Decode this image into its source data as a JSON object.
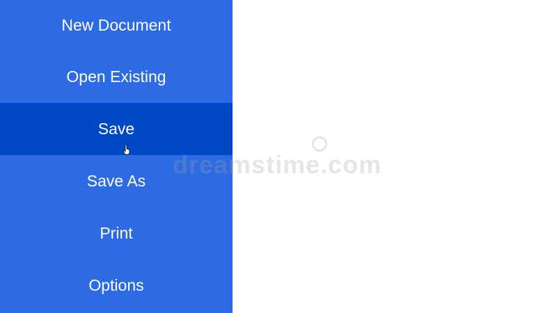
{
  "menu": {
    "items": [
      {
        "label": "New Document",
        "selected": false
      },
      {
        "label": "Open Existing",
        "selected": false
      },
      {
        "label": "Save",
        "selected": true
      },
      {
        "label": "Save As",
        "selected": false
      },
      {
        "label": "Print",
        "selected": false
      },
      {
        "label": "Options",
        "selected": false
      }
    ]
  },
  "watermark": {
    "text": "dreamstime.com"
  },
  "colors": {
    "menu_background": "#2d6be4",
    "menu_selected": "#0049c6",
    "menu_text": "#ffffff",
    "content_background": "#ffffff"
  },
  "icons": {
    "cursor": "hand-pointer-icon"
  }
}
